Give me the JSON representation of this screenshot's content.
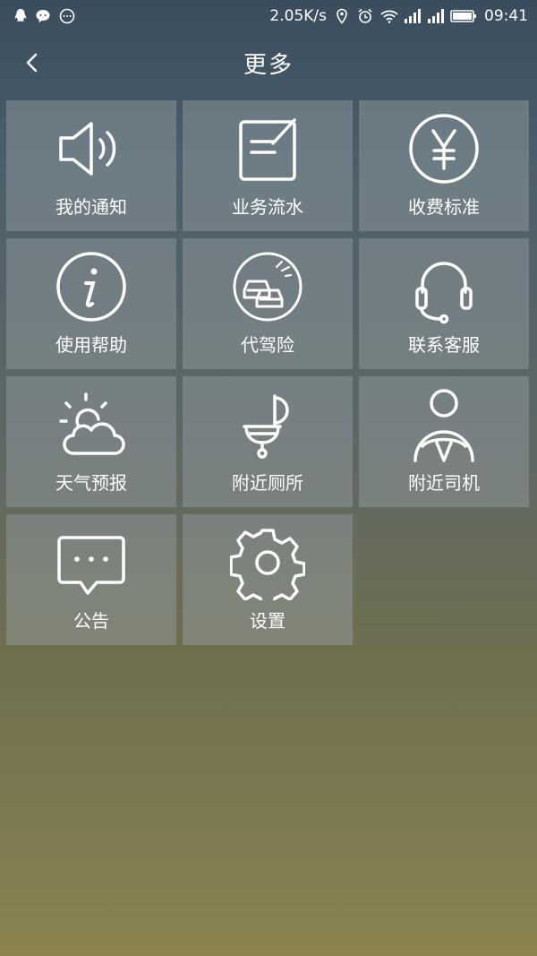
{
  "status_bar": {
    "network_speed": "2.05K/s",
    "time": "09:41",
    "left_icons": [
      "qq-icon",
      "wechat-icon",
      "message-icon"
    ],
    "right_icons": [
      "location-icon",
      "alarm-icon",
      "wifi-icon",
      "signal-icon",
      "signal-icon",
      "battery-icon"
    ]
  },
  "header": {
    "title": "更多",
    "back_icon": "back-arrow-icon"
  },
  "tiles": [
    {
      "label": "我的通知",
      "icon": "speaker-icon"
    },
    {
      "label": "业务流水",
      "icon": "edit-note-icon"
    },
    {
      "label": "收费标准",
      "icon": "yen-icon"
    },
    {
      "label": "使用帮助",
      "icon": "info-icon"
    },
    {
      "label": "代驾险",
      "icon": "car-insurance-icon"
    },
    {
      "label": "联系客服",
      "icon": "headset-icon"
    },
    {
      "label": "天气预报",
      "icon": "weather-icon"
    },
    {
      "label": "附近厕所",
      "icon": "toilet-icon"
    },
    {
      "label": "附近司机",
      "icon": "driver-icon"
    },
    {
      "label": "公告",
      "icon": "announcement-icon"
    },
    {
      "label": "设置",
      "icon": "gear-icon"
    }
  ]
}
